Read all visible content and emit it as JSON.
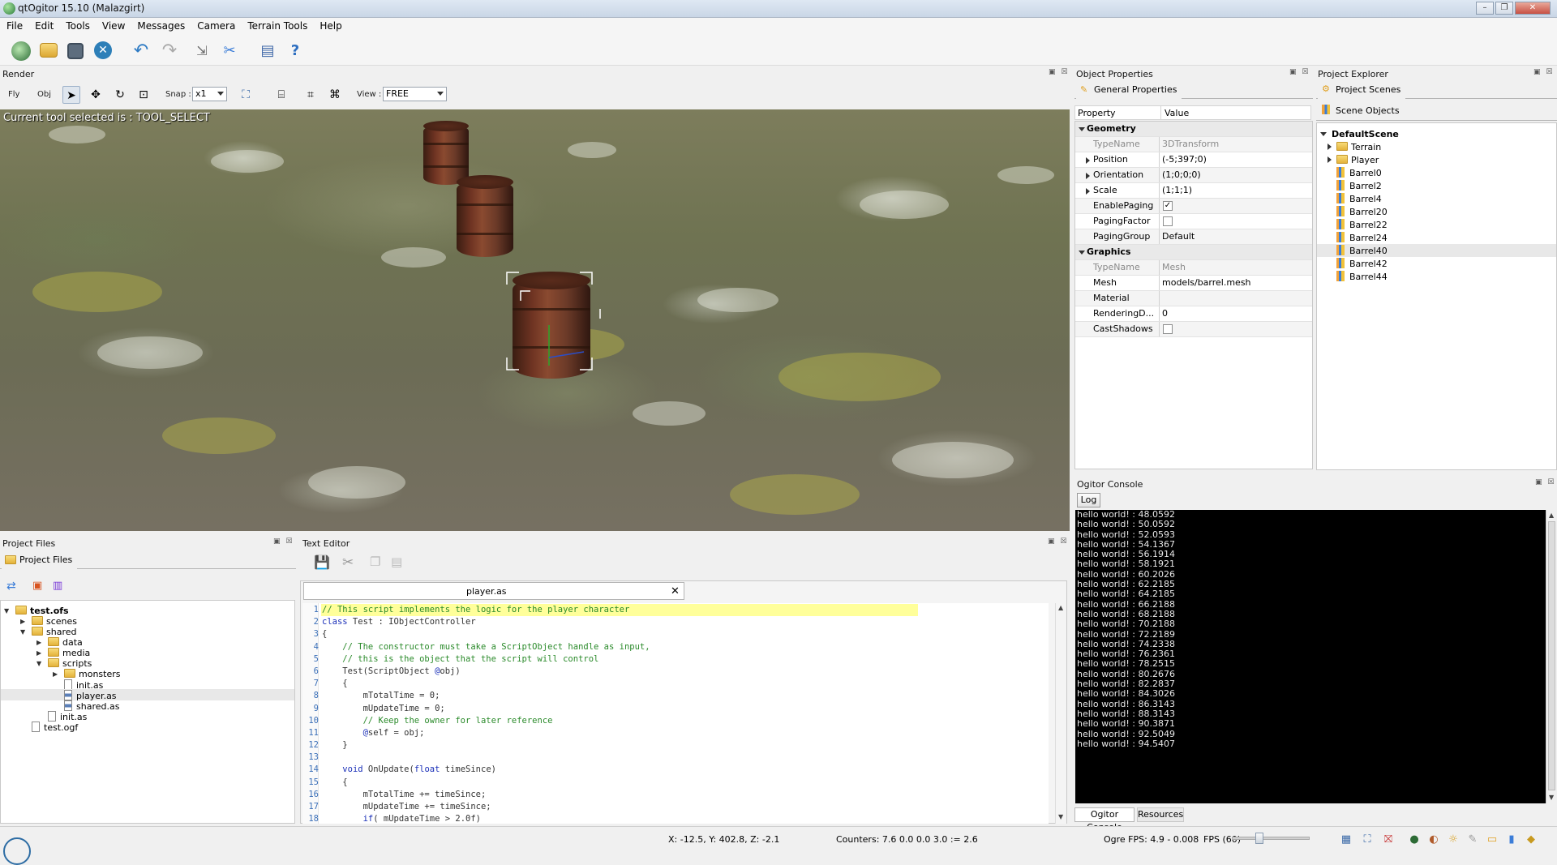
{
  "window": {
    "title": "qtOgitor 15.10 (Malazgirt)"
  },
  "menu": [
    "File",
    "Edit",
    "Tools",
    "View",
    "Messages",
    "Camera",
    "Terrain Tools",
    "Help"
  ],
  "toolbar_icons": [
    "ogitor-logo-icon",
    "open-icon",
    "save-icon",
    "close-icon",
    "undo-icon",
    "redo-icon",
    "export-icon",
    "settings-icon",
    "books-icon",
    "help-icon"
  ],
  "render": {
    "title": "Render",
    "fly": "Fly",
    "obj": "Obj",
    "snap_label": "Snap :",
    "snap_value": "x1",
    "view_label": "View :",
    "view_value": "FREE",
    "tool_status": "Current tool selected is : TOOL_SELECT"
  },
  "properties": {
    "title": "Object Properties",
    "tab": "General Properties",
    "col_property": "Property",
    "col_value": "Value",
    "groups": [
      {
        "name": "Geometry",
        "rows": [
          {
            "k": "TypeName",
            "v": "3DTransform",
            "gray": true
          },
          {
            "k": "Position",
            "v": "(-5;397;0)",
            "expand": true
          },
          {
            "k": "Orientation",
            "v": "(1;0;0;0)",
            "expand": true
          },
          {
            "k": "Scale",
            "v": "(1;1;1)",
            "expand": true
          },
          {
            "k": "EnablePaging",
            "v": "✓",
            "check": true
          },
          {
            "k": "PagingFactor",
            "v": "",
            "check": true
          },
          {
            "k": "PagingGroup",
            "v": "Default"
          }
        ]
      },
      {
        "name": "Graphics",
        "rows": [
          {
            "k": "TypeName",
            "v": "Mesh",
            "gray": true
          },
          {
            "k": "Mesh",
            "v": "models/barrel.mesh"
          },
          {
            "k": "Material",
            "v": ""
          },
          {
            "k": "RenderingD...",
            "v": "0"
          },
          {
            "k": "CastShadows",
            "v": "",
            "check": true
          }
        ]
      }
    ]
  },
  "explorer": {
    "title": "Project Explorer",
    "tab": "Project Scenes",
    "subtab": "Scene Objects",
    "root": "DefaultScene",
    "folders": [
      "Terrain",
      "Player"
    ],
    "items": [
      "Barrel0",
      "Barrel2",
      "Barrel4",
      "Barrel20",
      "Barrel22",
      "Barrel24",
      "Barrel40",
      "Barrel42",
      "Barrel44"
    ],
    "selected": "Barrel40"
  },
  "console": {
    "title": "Ogitor Console",
    "log_button": "Log",
    "lines": [
      "hello world! : 48.0592",
      "hello world! : 50.0592",
      "hello world! : 52.0593",
      "hello world! : 54.1367",
      "hello world! : 56.1914",
      "hello world! : 58.1921",
      "hello world! : 60.2026",
      "hello world! : 62.2185",
      "hello world! : 64.2185",
      "hello world! : 66.2188",
      "hello world! : 68.2188",
      "hello world! : 70.2188",
      "hello world! : 72.2189",
      "hello world! : 74.2338",
      "hello world! : 76.2361",
      "hello world! : 78.2515",
      "hello world! : 80.2676",
      "hello world! : 82.2837",
      "hello world! : 84.3026",
      "hello world! : 86.3143",
      "hello world! : 88.3143",
      "hello world! : 90.3871",
      "hello world! : 92.5049",
      "hello world! : 94.5407"
    ],
    "tabs": [
      "Ogitor Console",
      "Resources"
    ]
  },
  "files": {
    "title": "Project Files",
    "tab": "Project Files",
    "tree": [
      {
        "label": "test.ofs",
        "depth": 0,
        "type": "folder",
        "bold": true,
        "arrow": "down"
      },
      {
        "label": "scenes",
        "depth": 1,
        "type": "folder",
        "arrow": "right"
      },
      {
        "label": "shared",
        "depth": 1,
        "type": "folder",
        "arrow": "down"
      },
      {
        "label": "data",
        "depth": 2,
        "type": "folder",
        "arrow": "right"
      },
      {
        "label": "media",
        "depth": 2,
        "type": "folder",
        "arrow": "right"
      },
      {
        "label": "scripts",
        "depth": 2,
        "type": "folder",
        "arrow": "down"
      },
      {
        "label": "monsters",
        "depth": 3,
        "type": "folder",
        "arrow": "right"
      },
      {
        "label": "init.as",
        "depth": 3,
        "type": "file"
      },
      {
        "label": "player.as",
        "depth": 3,
        "type": "as",
        "selected": true
      },
      {
        "label": "shared.as",
        "depth": 3,
        "type": "as"
      },
      {
        "label": "init.as",
        "depth": 2,
        "type": "file"
      },
      {
        "label": "test.ogf",
        "depth": 1,
        "type": "file"
      }
    ]
  },
  "editor": {
    "title": "Text Editor",
    "tab": "player.as",
    "lines": [
      [
        {
          "t": "// This script implements the logic for the player character",
          "c": "cm"
        }
      ],
      [
        {
          "t": "class",
          "c": "kw"
        },
        {
          "t": " Test : IObjectController",
          "c": "pl"
        }
      ],
      [
        {
          "t": "{",
          "c": "pl"
        }
      ],
      [
        {
          "t": "    // The constructor must take a ScriptObject handle as input,",
          "c": "cm"
        }
      ],
      [
        {
          "t": "    // this is the object that the script will control",
          "c": "cm"
        }
      ],
      [
        {
          "t": "    Test(ScriptObject ",
          "c": "pl"
        },
        {
          "t": "@",
          "c": "kw"
        },
        {
          "t": "obj)",
          "c": "pl"
        }
      ],
      [
        {
          "t": "    {",
          "c": "pl"
        }
      ],
      [
        {
          "t": "        mTotalTime = 0;",
          "c": "pl"
        }
      ],
      [
        {
          "t": "        mUpdateTime = 0;",
          "c": "pl"
        }
      ],
      [
        {
          "t": "        // Keep the owner for later reference",
          "c": "cm"
        }
      ],
      [
        {
          "t": "        ",
          "c": "pl"
        },
        {
          "t": "@",
          "c": "kw"
        },
        {
          "t": "self = obj;",
          "c": "pl"
        }
      ],
      [
        {
          "t": "    }",
          "c": "pl"
        }
      ],
      [
        {
          "t": "",
          "c": "pl"
        }
      ],
      [
        {
          "t": "    ",
          "c": "pl"
        },
        {
          "t": "void",
          "c": "kw"
        },
        {
          "t": " OnUpdate(",
          "c": "pl"
        },
        {
          "t": "float",
          "c": "kw"
        },
        {
          "t": " timeSince)",
          "c": "pl"
        }
      ],
      [
        {
          "t": "    {",
          "c": "pl"
        }
      ],
      [
        {
          "t": "        mTotalTime += timeSince;",
          "c": "pl"
        }
      ],
      [
        {
          "t": "        mUpdateTime += timeSince;",
          "c": "pl"
        }
      ],
      [
        {
          "t": "        ",
          "c": "pl"
        },
        {
          "t": "if",
          "c": "kw"
        },
        {
          "t": "( mUpdateTime > 2.0f)",
          "c": "pl"
        }
      ]
    ]
  },
  "status": {
    "coords": "X: -12.5, Y: 402.8, Z: -2.1",
    "counters": "Counters: 7.6 0.0 0.0 3.0 := 2.6",
    "fps": "Ogre FPS: 4.9 - 0.008",
    "fps_limit": "FPS (60)"
  }
}
